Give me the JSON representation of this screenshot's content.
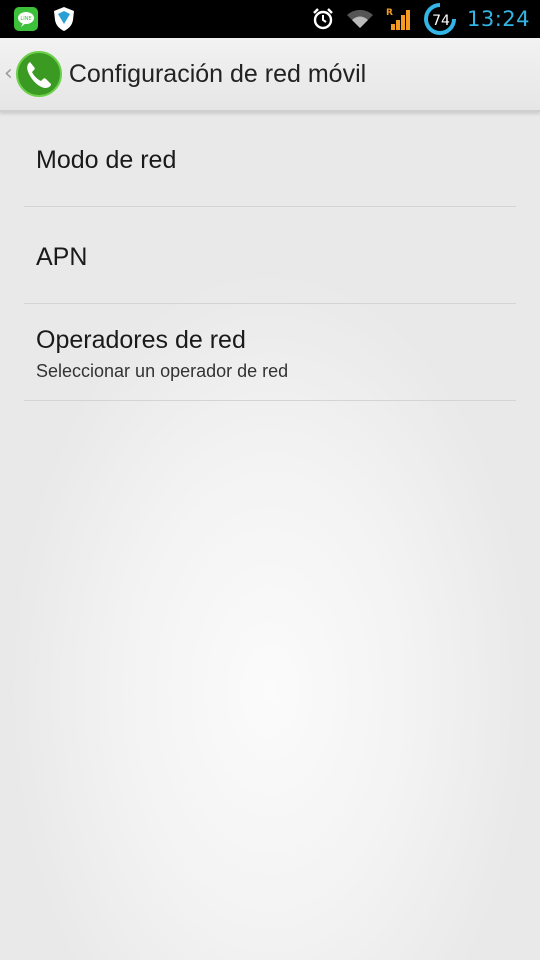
{
  "status_bar": {
    "time": "13:24",
    "roaming_indicator": "R",
    "battery_level": "74",
    "left_icons": [
      "line-app-icon",
      "shield-app-icon"
    ],
    "right_icons": [
      "alarm-icon",
      "wifi-icon",
      "signal-icon",
      "battery-icon"
    ],
    "accent_color": "#33b5e5",
    "signal_color": "#f59a23"
  },
  "action_bar": {
    "title": "Configuración de red móvil",
    "app_icon": "phone-app-icon"
  },
  "settings": {
    "items": [
      {
        "title": "Modo de red"
      },
      {
        "title": "APN"
      },
      {
        "title": "Operadores de red",
        "summary": "Seleccionar un operador de red"
      }
    ]
  }
}
